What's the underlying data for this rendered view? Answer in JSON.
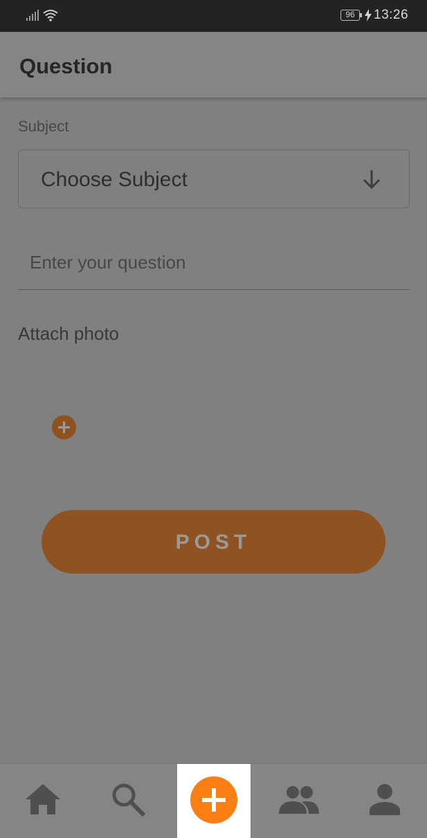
{
  "status_bar": {
    "battery": "96",
    "time": "13:26"
  },
  "app_bar": {
    "title": "Question"
  },
  "form": {
    "subject_label": "Subject",
    "subject_value": "Choose Subject",
    "question_placeholder": "Enter your question",
    "attach_label": "Attach photo",
    "post_label": "POST"
  },
  "colors": {
    "accent": "#fb7e14",
    "scrim_bg": "#808080",
    "status_bar_bg": "#232323"
  },
  "bottom_nav": {
    "items": [
      {
        "icon": "home-icon"
      },
      {
        "icon": "search-icon"
      },
      {
        "icon": "add-icon",
        "active": true
      },
      {
        "icon": "group-icon"
      },
      {
        "icon": "person-icon"
      }
    ]
  }
}
